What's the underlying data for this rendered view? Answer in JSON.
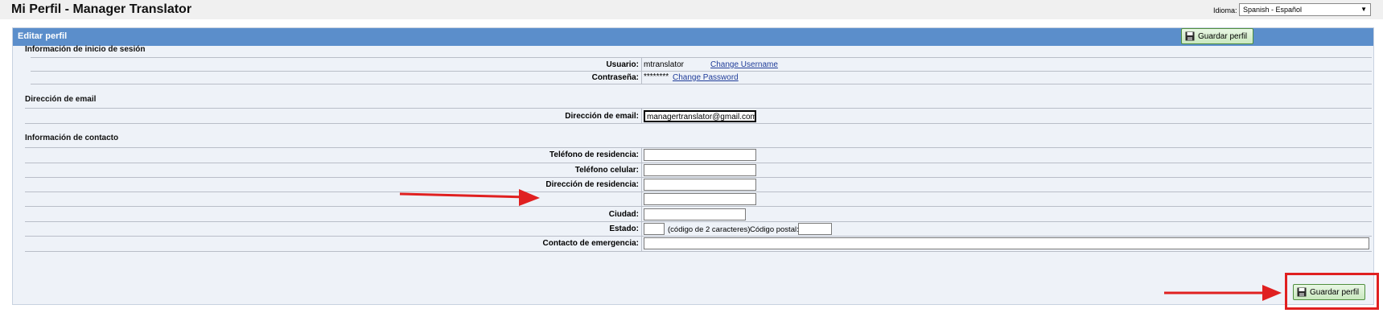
{
  "header": {
    "title": "Mi Perfil - Manager Translator",
    "language_label": "Idioma:",
    "language_value": "Spanish - Español"
  },
  "panel": {
    "title": "Editar perfil",
    "save_label": "Guardar perfil"
  },
  "login_section": {
    "title": "Información de inicio de sesión",
    "username_label": "Usuario:",
    "username_value": "mtranslator",
    "change_username": "Change Username",
    "password_label": "Contraseña:",
    "password_value": "********",
    "change_password": "Change Password"
  },
  "email_section": {
    "title": "Dirección de email",
    "email_label": "Dirección de email:",
    "email_value": "managertranslator@gmail.com"
  },
  "contact_section": {
    "title": "Información de contacto",
    "home_phone_label": "Teléfono de residencia:",
    "home_phone_value": "",
    "cell_phone_label": "Teléfono celular:",
    "cell_phone_value": "",
    "address_label": "Dirección de residencia:",
    "address_line1_value": "",
    "address_line2_value": "",
    "city_label": "Ciudad:",
    "city_value": "",
    "state_label": "Estado:",
    "state_value": "",
    "state_hint": "(código de 2 caracteres)",
    "zip_label": "Código postal:",
    "zip_value": "",
    "emergency_label": "Contacto de emergencia:",
    "emergency_value": ""
  },
  "colors": {
    "header_bar": "#5b8ecb",
    "panel_bg": "#eef2f8",
    "save_button": "#c9e8bf",
    "annotation": "#e02020"
  }
}
